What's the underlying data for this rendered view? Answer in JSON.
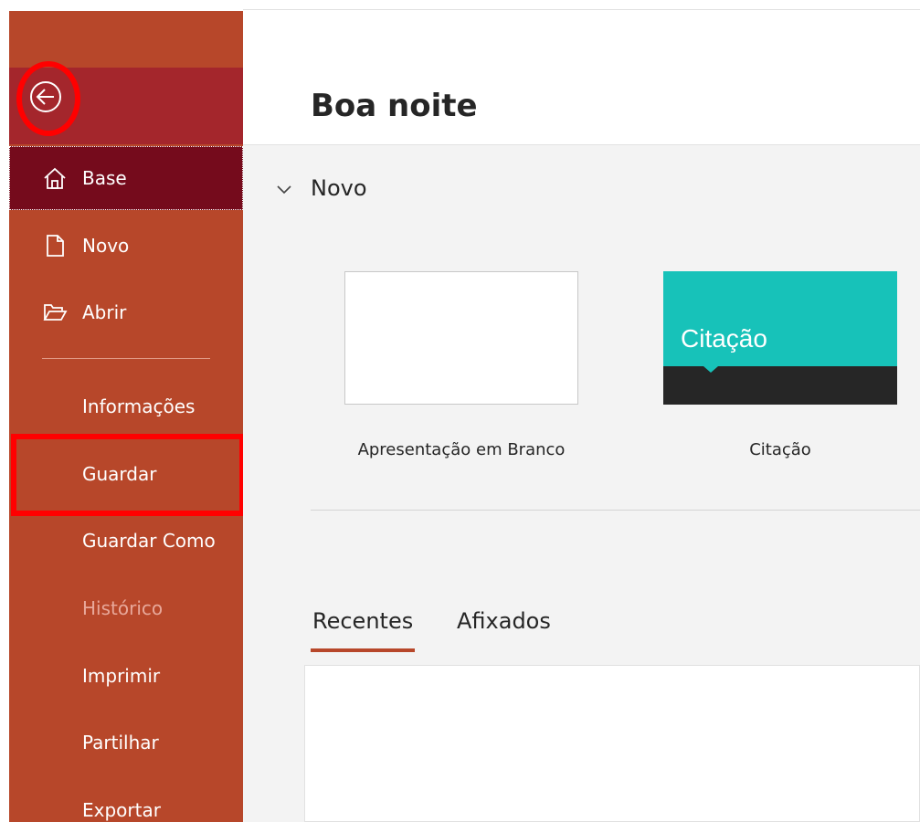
{
  "header": {
    "greeting": "Boa noite"
  },
  "sidebar": {
    "items": [
      {
        "label": "Base",
        "icon": "home-icon",
        "state": "active"
      },
      {
        "label": "Novo",
        "icon": "new-document-icon",
        "state": "normal"
      },
      {
        "label": "Abrir",
        "icon": "folder-open-icon",
        "state": "normal"
      },
      {
        "label": "Informações",
        "state": "normal"
      },
      {
        "label": "Guardar",
        "state": "highlighted"
      },
      {
        "label": "Guardar Como",
        "state": "normal"
      },
      {
        "label": "Histórico",
        "state": "disabled"
      },
      {
        "label": "Imprimir",
        "state": "normal"
      },
      {
        "label": "Partilhar",
        "state": "normal"
      },
      {
        "label": "Exportar",
        "state": "normal"
      }
    ],
    "back_icon": "back-arrow-circle-icon"
  },
  "new_section": {
    "title": "Novo",
    "toggle_icon": "chevron-down-icon",
    "templates": [
      {
        "label": "Apresentação em Branco"
      },
      {
        "label": "Citação",
        "thumb_text": "Citação"
      }
    ]
  },
  "files_tabs": [
    {
      "label": "Recentes",
      "selected": true
    },
    {
      "label": "Afixados",
      "selected": false
    }
  ],
  "colors": {
    "sidebar": "#b7472a",
    "sidebar_active": "#750b1c",
    "sidebar_top": "#a4262c",
    "highlight": "#ff0000",
    "citacao_teal": "#17c2b9",
    "tab_accent": "#b7472a"
  }
}
